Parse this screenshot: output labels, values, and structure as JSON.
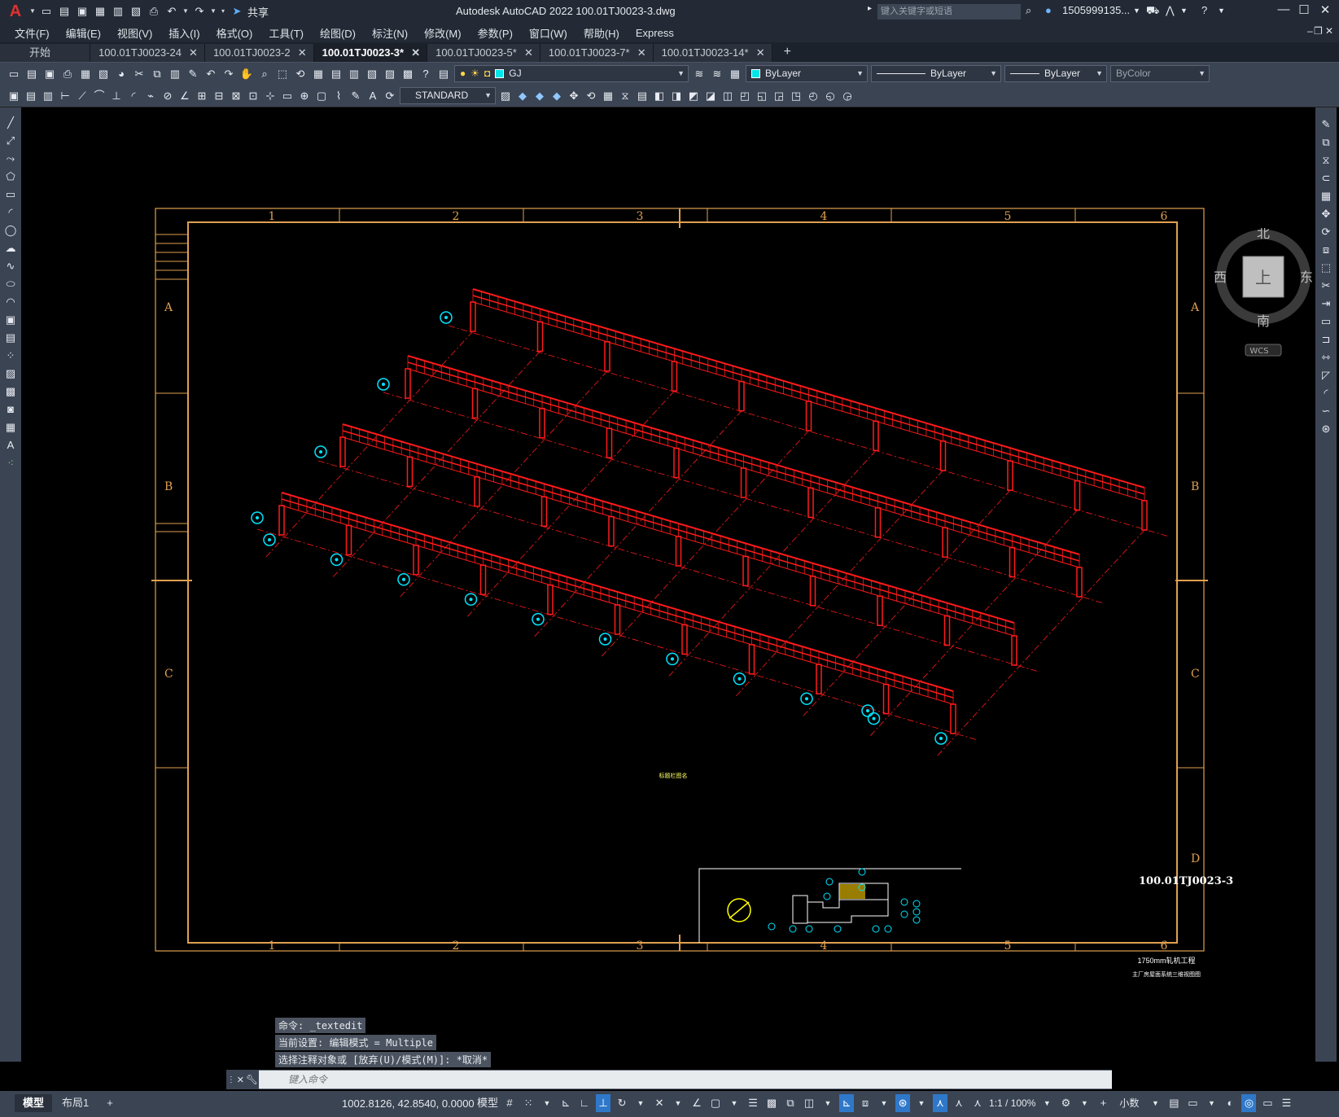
{
  "title_bar": {
    "app_logo": "A",
    "share_label": "共享",
    "title": "Autodesk AutoCAD 2022    100.01TJ0023-3.dwg",
    "search_placeholder": "键入关键字或短语",
    "user": "1505999135...",
    "icons": [
      "new-icon",
      "open-icon",
      "save-icon",
      "save-as-icon",
      "open-web-icon",
      "save-web-icon",
      "plot-icon",
      "undo-icon",
      "redo-icon",
      "share-icon",
      "search-icon",
      "user-icon",
      "cart-icon",
      "autodesk-app-icon",
      "help-icon",
      "minimize-icon",
      "maximize-icon",
      "close-icon"
    ]
  },
  "menu": [
    "文件(F)",
    "编辑(E)",
    "视图(V)",
    "插入(I)",
    "格式(O)",
    "工具(T)",
    "绘图(D)",
    "标注(N)",
    "修改(M)",
    "参数(P)",
    "窗口(W)",
    "帮助(H)",
    "Express"
  ],
  "tabs": [
    {
      "label": "开始",
      "closable": false,
      "active": false
    },
    {
      "label": "100.01TJ0023-24",
      "closable": true,
      "active": false
    },
    {
      "label": "100.01TJ0023-2",
      "closable": true,
      "active": false
    },
    {
      "label": "100.01TJ0023-3*",
      "closable": true,
      "active": true
    },
    {
      "label": "100.01TJ0023-5*",
      "closable": true,
      "active": false
    },
    {
      "label": "100.01TJ0023-7*",
      "closable": true,
      "active": false
    },
    {
      "label": "100.01TJ0023-14*",
      "closable": true,
      "active": false
    }
  ],
  "toolbar": {
    "layer": "GJ",
    "color": "ByLayer",
    "linetype": "ByLayer",
    "lineweight": "ByLayer",
    "plotstyle": "ByColor",
    "text_style": "STANDARD",
    "layer_swatch_color": "#00e5e8"
  },
  "drawing": {
    "border_color": "#e0a050",
    "structure_color": "#ff1a1a",
    "axis_color": "#00e5ff",
    "column_labels": [
      "1",
      "2",
      "3",
      "4",
      "5",
      "6"
    ],
    "row_labels": [
      "A",
      "B",
      "C",
      "D"
    ],
    "drawing_number": "100.01TJ0023-3",
    "caption": "标题栏图名",
    "project_name": "1750mm轧机工程",
    "sheet_title": "主厂房屋面系统三维视图图"
  },
  "viewcube": {
    "north": "北",
    "south": "南",
    "east": "东",
    "west": "西",
    "top": "上",
    "wcs": "WCS"
  },
  "command_history": [
    "命令: _textedit",
    "当前设置: 编辑模式 = Multiple",
    "选择注释对象或 [放弃(U)/模式(M)]: *取消*"
  ],
  "command_placeholder": "键入命令",
  "status": {
    "layout_tabs": [
      "模型",
      "布局1"
    ],
    "coordinates": "1002.8126, 42.8540, 0.0000",
    "model_label": "模型",
    "scale": "1:1 / 100%",
    "units": "小数"
  }
}
